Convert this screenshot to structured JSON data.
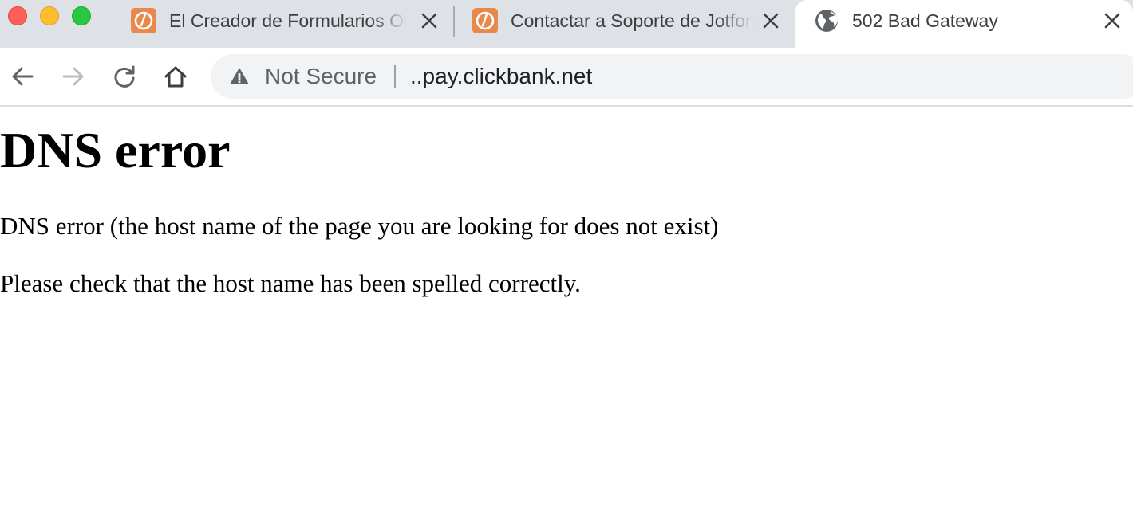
{
  "window": {
    "controls": [
      "close",
      "minimize",
      "maximize"
    ]
  },
  "tabs": [
    {
      "title": "El Creador de Formularios Online Más Fácil",
      "favicon": "jotform-icon",
      "active": false
    },
    {
      "title": "Contactar a Soporte de Jotform",
      "favicon": "jotform-icon",
      "active": false
    },
    {
      "title": "502 Bad Gateway",
      "favicon": "globe-icon",
      "active": true
    }
  ],
  "toolbar": {
    "back_icon": "back-arrow-icon",
    "forward_icon": "forward-arrow-icon",
    "reload_icon": "reload-icon",
    "home_icon": "home-icon"
  },
  "omnibox": {
    "security_label": "Not Secure",
    "security_icon": "warning-triangle-icon",
    "url": "..pay.clickbank.net"
  },
  "page": {
    "heading": "DNS error",
    "message": "DNS error (the host name of the page you are looking for does not exist)",
    "hint": "Please check that the host name has been spelled correctly."
  },
  "colors": {
    "tabstrip_bg": "#dee1e6",
    "omnibox_bg": "#f1f3f4",
    "favicon_jotform": "#e8884a"
  }
}
